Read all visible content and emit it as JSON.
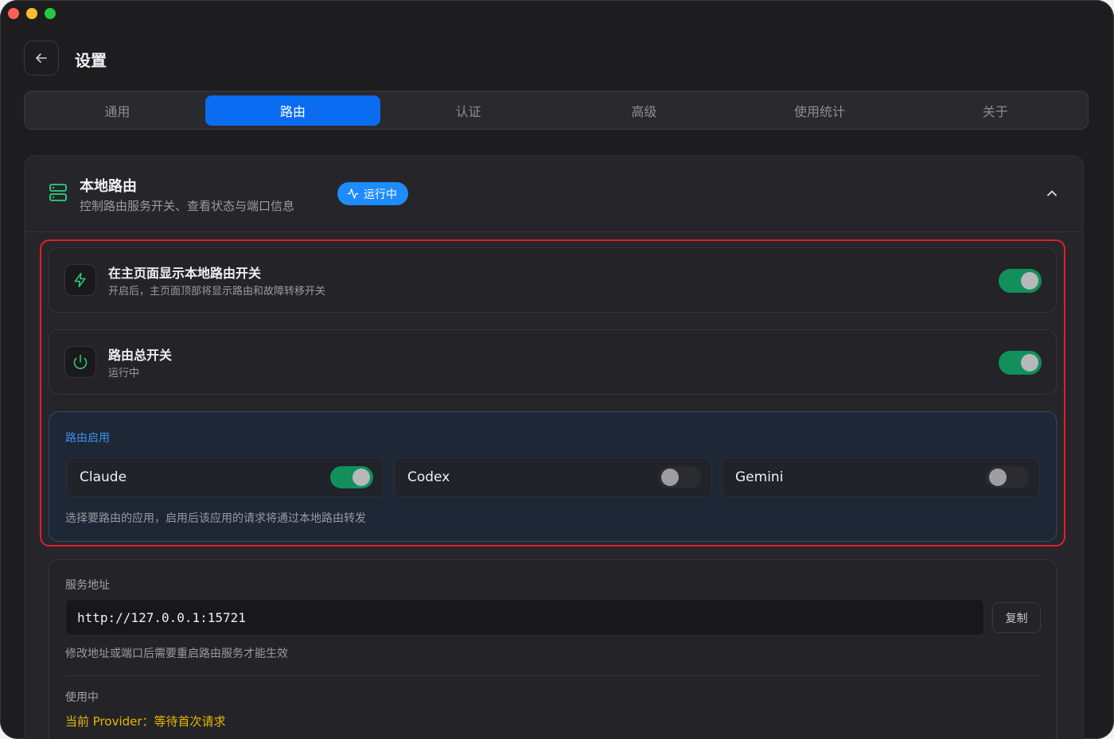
{
  "header": {
    "title": "设置"
  },
  "tabs": [
    {
      "label": "通用",
      "active": false
    },
    {
      "label": "路由",
      "active": true
    },
    {
      "label": "认证",
      "active": false
    },
    {
      "label": "高级",
      "active": false
    },
    {
      "label": "使用统计",
      "active": false
    },
    {
      "label": "关于",
      "active": false
    }
  ],
  "section": {
    "title": "本地路由",
    "subtitle": "控制路由服务开关、查看状态与端口信息",
    "status": "运行中",
    "icon": "server-icon"
  },
  "settings": [
    {
      "title": "在主页面显示本地路由开关",
      "desc": "开启后，主页面顶部将显示路由和故障转移开关",
      "enabled": true,
      "icon": "lightning-icon"
    },
    {
      "title": "路由总开关",
      "desc": "运行中",
      "enabled": true,
      "icon": "power-icon"
    }
  ],
  "routing_apps": {
    "label": "路由启用",
    "apps": [
      {
        "name": "Claude",
        "enabled": true
      },
      {
        "name": "Codex",
        "enabled": false
      },
      {
        "name": "Gemini",
        "enabled": false
      }
    ],
    "hint": "选择要路由的应用，启用后该应用的请求将通过本地路由转发"
  },
  "service": {
    "label": "服务地址",
    "address": "http://127.0.0.1:15721",
    "copy_label": "复制",
    "hint": "修改地址或端口后需要重启路由服务才能生效",
    "in_use_label": "使用中",
    "provider_text": "当前 Provider：等待首次请求"
  },
  "colors": {
    "accent": "#0a6cf0",
    "badge": "#1e8bff",
    "toggle_on": "#11905c",
    "icon_green": "#2bd17e",
    "highlight_border": "#e0202a",
    "provider_text": "#e6b800"
  }
}
